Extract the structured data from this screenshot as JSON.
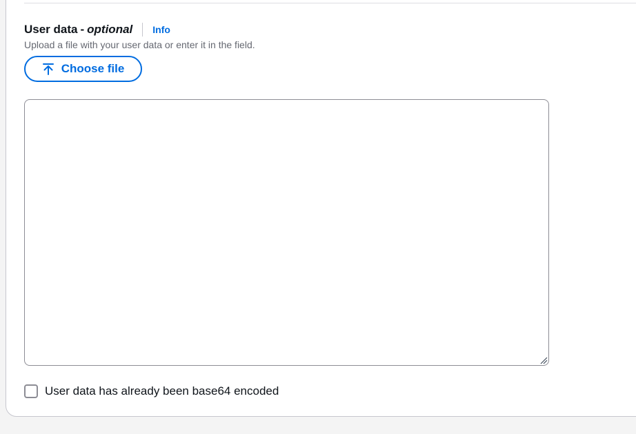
{
  "field": {
    "label": "User data",
    "separator": "-",
    "optional": "optional",
    "info_link": "Info",
    "description": "Upload a file with your user data or enter it in the field."
  },
  "upload_button": {
    "label": "Choose file",
    "icon": "upload-icon"
  },
  "user_data_textarea": {
    "value": "",
    "placeholder": ""
  },
  "base64_checkbox": {
    "label": "User data has already been base64 encoded",
    "checked": false
  },
  "colors": {
    "accent": "#006ce0",
    "text": "#0f141a",
    "secondary_text": "#656871",
    "border": "#8c8c94",
    "background": "#f4f4f4"
  }
}
